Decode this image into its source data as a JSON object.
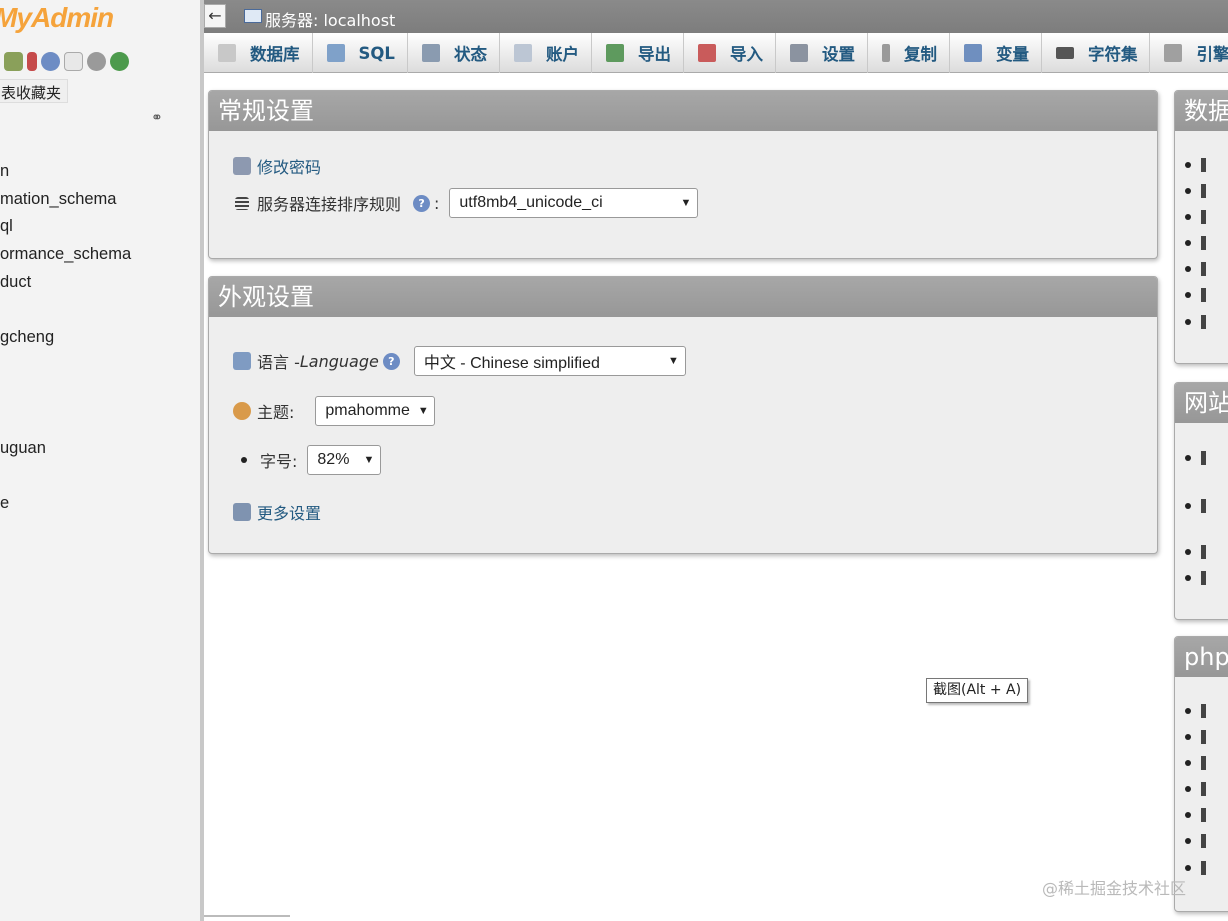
{
  "nav": {
    "logo": "oMyAdmin",
    "favorites_button": "表收藏夹",
    "databases": [
      "n",
      "mation_schema",
      "ql",
      "ormance_schema",
      "duct",
      "",
      "gcheng",
      "",
      "",
      "",
      "uguan",
      "",
      "e"
    ]
  },
  "serverbar": {
    "back": "←",
    "title": "服务器: localhost"
  },
  "tabs": [
    {
      "label": "数据库",
      "icon": "database-icon",
      "color": "#c8c8c8"
    },
    {
      "label": "SQL",
      "icon": "sql-icon",
      "color": "#7fa1c9"
    },
    {
      "label": "状态",
      "icon": "status-icon",
      "color": "#8a9bb0"
    },
    {
      "label": "账户",
      "icon": "accounts-icon",
      "color": "#bcc6d4"
    },
    {
      "label": "导出",
      "icon": "export-icon",
      "color": "#5e9a5e"
    },
    {
      "label": "导入",
      "icon": "import-icon",
      "color": "#c95b5b"
    },
    {
      "label": "设置",
      "icon": "wrench-icon",
      "color": "#8b93a0"
    },
    {
      "label": "复制",
      "icon": "replication-icon",
      "color": "#9a9a9a"
    },
    {
      "label": "变量",
      "icon": "variables-icon",
      "color": "#6f8fbf"
    },
    {
      "label": "字符集",
      "icon": "charset-icon",
      "color": "#555555"
    },
    {
      "label": "引擎",
      "icon": "engines-icon",
      "color": "#a0a0a0"
    }
  ],
  "general_settings": {
    "title": "常规设置",
    "change_password": "修改密码",
    "collation_label": "服务器连接排序规则",
    "collation_colon": ":",
    "collation_value": "utf8mb4_unicode_ci"
  },
  "appearance_settings": {
    "title": "外观设置",
    "language_label": "语言 - ",
    "language_label_en": "Language",
    "language_value": "中文 - Chinese simplified",
    "theme_label": "主题:",
    "theme_value": "pmahomme",
    "font_size_label": "字号:",
    "font_size_value": "82%",
    "more_settings": "更多设置"
  },
  "right_panels": [
    {
      "title": "数据",
      "items": 7
    },
    {
      "title": "网站",
      "items": 4
    },
    {
      "title": "php",
      "items": 7
    }
  ],
  "tooltip": "截图(Alt + A)",
  "watermark": "@稀土掘金技术社区"
}
